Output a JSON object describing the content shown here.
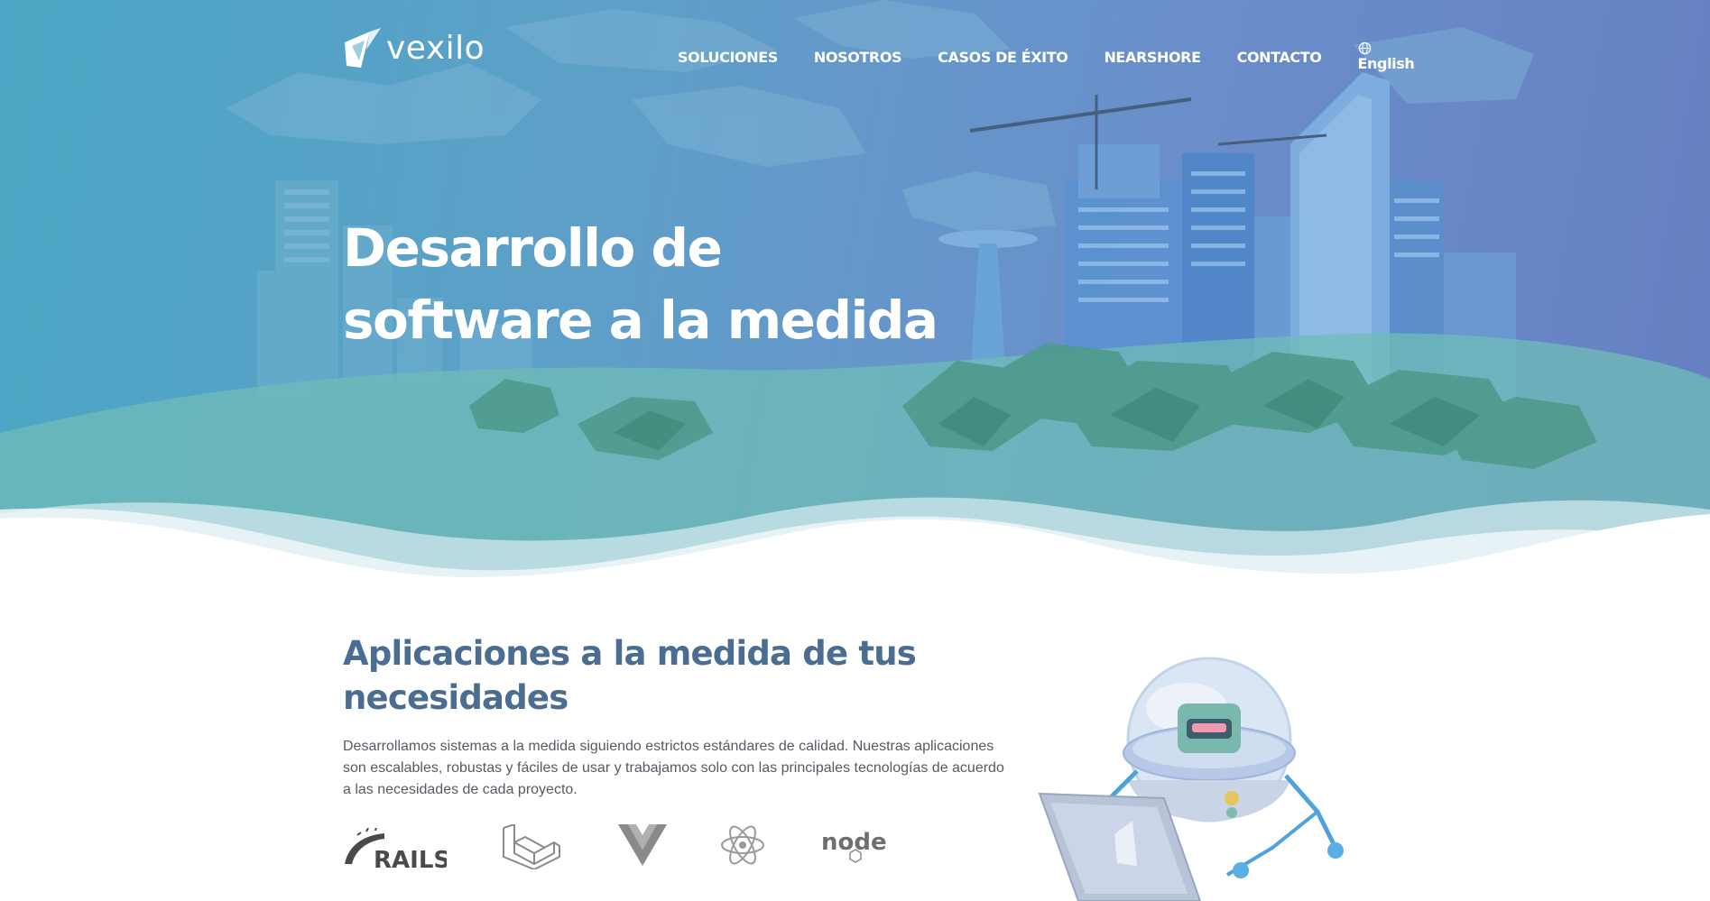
{
  "brand": {
    "logo_text": "vexilo"
  },
  "nav": {
    "items": [
      {
        "label": "SOLUCIONES"
      },
      {
        "label": "NOSOTROS"
      },
      {
        "label": "CASOS DE ÉXITO"
      },
      {
        "label": "NEARSHORE"
      },
      {
        "label": "CONTACTO"
      }
    ],
    "language": {
      "label": "English",
      "icon": "globe-icon"
    }
  },
  "hero": {
    "headline_line1": "Desarrollo de",
    "headline_line2": "software a la medida"
  },
  "section": {
    "title_line1": "Aplicaciones a la medida de tus",
    "title_line2": "necesidades",
    "body": "Desarrollamos sistemas a la medida siguiendo estrictos estándares de calidad. Nuestras aplicaciones son escalables, robustas y fáciles de usar y trabajamos solo con las principales tecnologías de acuerdo a las necesidades de cada proyecto."
  },
  "technologies": [
    {
      "name": "RAILS",
      "icon": "rails-logo"
    },
    {
      "name": "Laravel",
      "icon": "laravel-logo"
    },
    {
      "name": "Vue",
      "icon": "vue-logo"
    },
    {
      "name": "React",
      "icon": "react-logo"
    },
    {
      "name": "node",
      "icon": "nodejs-logo"
    }
  ],
  "colors": {
    "hero_start": "#4aa6c4",
    "hero_end": "#6680c2",
    "section_title": "#4a6d91",
    "body_text": "#555b63",
    "tech_logos": "#8a8a8a"
  }
}
